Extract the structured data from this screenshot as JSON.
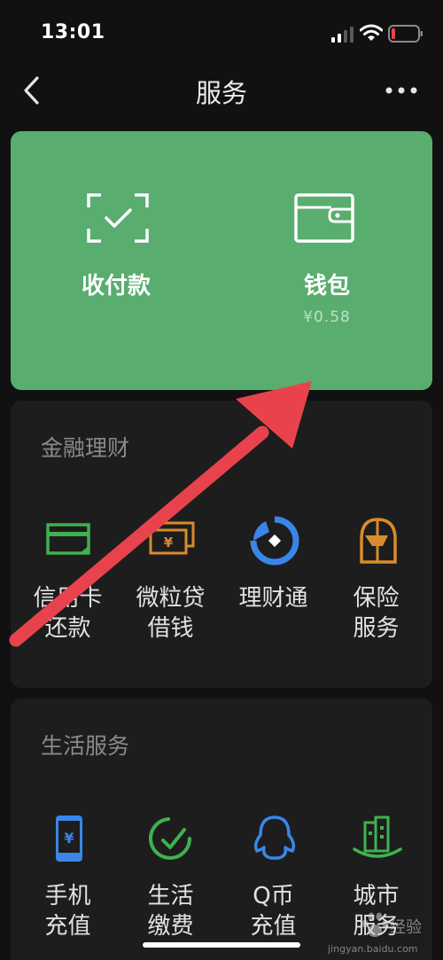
{
  "status_bar": {
    "time": "13:01"
  },
  "nav": {
    "title": "服务"
  },
  "top_card": {
    "pay": {
      "label": "收付款",
      "icon": "scan-check-icon"
    },
    "wallet": {
      "label": "钱包",
      "balance": "¥0.58",
      "icon": "wallet-icon"
    }
  },
  "finance": {
    "title": "金融理财",
    "items": [
      {
        "label": "信用卡\n还款",
        "icon": "credit-card-icon",
        "color": "#3fb14f"
      },
      {
        "label": "微粒贷\n借钱",
        "icon": "loan-icon",
        "color": "#d98b2b"
      },
      {
        "label": "理财通",
        "icon": "wealth-icon",
        "color": "#3a86e8"
      },
      {
        "label": "保险\n服务",
        "icon": "insurance-icon",
        "color": "#d98b2b"
      }
    ]
  },
  "life": {
    "title": "生活服务",
    "items": [
      {
        "label": "手机\n充值",
        "icon": "phone-topup-icon",
        "color": "#3a86e8"
      },
      {
        "label": "生活\n缴费",
        "icon": "utility-icon",
        "color": "#3fb14f"
      },
      {
        "label": "Q币\n充值",
        "icon": "qq-coin-icon",
        "color": "#3a86e8"
      },
      {
        "label": "城市\n服务",
        "icon": "city-icon",
        "color": "#3fb14f"
      }
    ]
  },
  "watermark": {
    "text": "经验",
    "url": "jingyan.baidu.com"
  },
  "colors": {
    "card_green": "#59ad6e",
    "arrow_red": "#e8434d",
    "background": "#111111",
    "section_bg": "#1d1d1d"
  }
}
